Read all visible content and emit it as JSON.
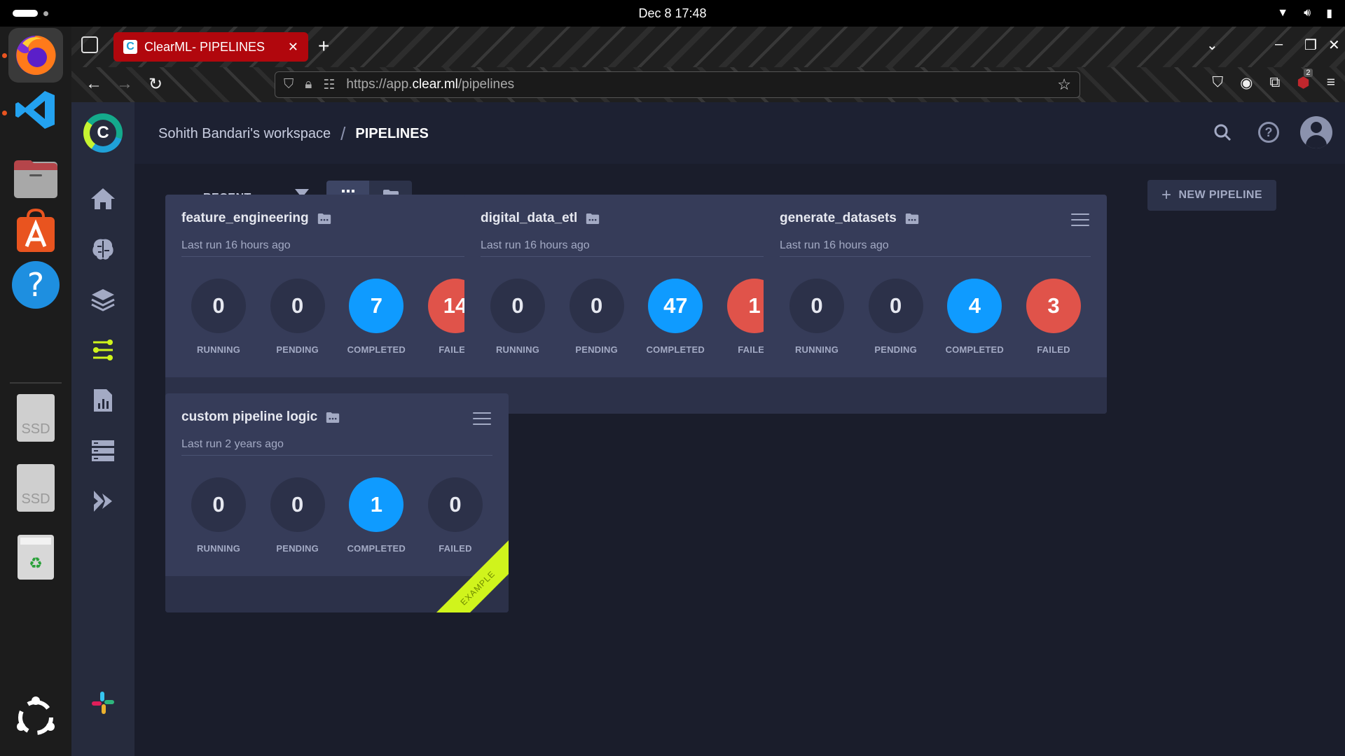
{
  "os": {
    "clock": "Dec 8  17:48"
  },
  "dock": {
    "items": [
      {
        "name": "firefox"
      },
      {
        "name": "vscode"
      },
      {
        "name": "files"
      },
      {
        "name": "app-center"
      },
      {
        "name": "help"
      },
      {
        "name": "ssd-drive-1",
        "label": "SSD"
      },
      {
        "name": "ssd-drive-2",
        "label": "SSD"
      },
      {
        "name": "trash"
      },
      {
        "name": "show-apps"
      }
    ]
  },
  "browser": {
    "tab_title": "ClearML- PIPELINES",
    "tab_close": "✕",
    "new_tab": "+",
    "url_prefix": "https://app.",
    "url_host": "clear.ml",
    "url_path": "/pipelines",
    "badge_count": "2"
  },
  "app": {
    "logo_letter": "C",
    "breadcrumb": {
      "workspace": "Sohith Bandari's workspace",
      "separator": "/",
      "page": "PIPELINES"
    },
    "toolbar": {
      "sort_label": "RECENT",
      "new_pipeline_label": "NEW PIPELINE",
      "new_pipeline_icon": "+"
    },
    "stat_labels": {
      "running": "RUNNING",
      "pending": "PENDING",
      "completed": "COMPLETED",
      "failed": "FAILED"
    },
    "pipelines": [
      {
        "name": "feature_engineering",
        "last_run": "Last run 16 hours ago",
        "running": "0",
        "pending": "0",
        "completed": "7",
        "failed": "14",
        "failed_highlight": true
      },
      {
        "name": "digital_data_etl",
        "last_run": "Last run 16 hours ago",
        "running": "0",
        "pending": "0",
        "completed": "47",
        "failed": "1",
        "failed_highlight": true
      },
      {
        "name": "generate_datasets",
        "last_run": "Last run 16 hours ago",
        "running": "0",
        "pending": "0",
        "completed": "4",
        "failed": "3",
        "failed_highlight": true
      },
      {
        "name": "custom pipeline logic",
        "last_run": "Last run 2 years ago",
        "running": "0",
        "pending": "0",
        "completed": "1",
        "failed": "0",
        "failed_highlight": false,
        "ribbon": "EXAMPLE"
      }
    ]
  },
  "colors": {
    "completed": "#0f9bff",
    "failed": "#e0534a",
    "example_ribbon": "#d0f41c",
    "tab_active": "#b1070d"
  }
}
